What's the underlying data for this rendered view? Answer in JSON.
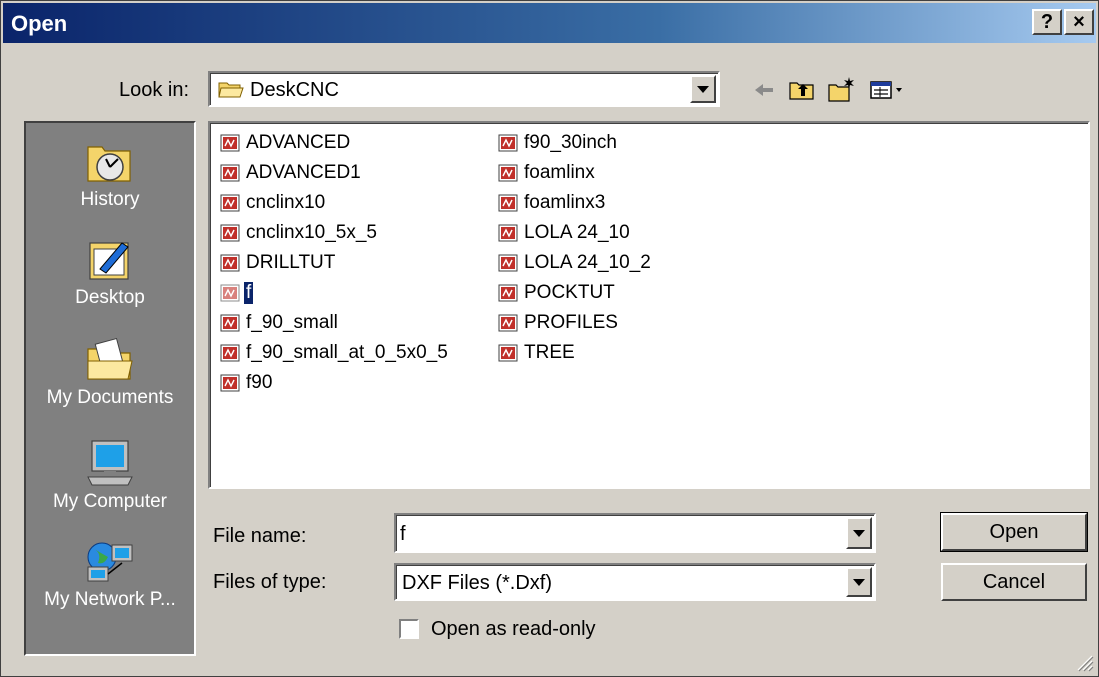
{
  "window": {
    "title": "Open",
    "help_label": "?",
    "close_label": "×"
  },
  "look_in": {
    "label": "Look in:",
    "value": "DeskCNC"
  },
  "toolbar": {
    "icons": [
      "back-arrow-icon",
      "up-one-level-icon",
      "new-folder-icon",
      "view-menu-icon"
    ]
  },
  "places": [
    {
      "label": "History",
      "icon": "history-icon"
    },
    {
      "label": "Desktop",
      "icon": "desktop-icon"
    },
    {
      "label": "My Documents",
      "icon": "my-documents-icon"
    },
    {
      "label": "My Computer",
      "icon": "my-computer-icon"
    },
    {
      "label": "My Network P...",
      "icon": "network-places-icon"
    }
  ],
  "files": {
    "column1": [
      "ADVANCED",
      "ADVANCED1",
      "cnclinx10",
      "cnclinx10_5x_5",
      "DRILLTUT",
      "f",
      "f_90_small",
      "f_90_small_at_0_5x0_5",
      "f90"
    ],
    "column2": [
      "f90_30inch",
      "foamlinx",
      "foamlinx3",
      "LOLA 24_10",
      "LOLA 24_10_2",
      "POCKTUT",
      "PROFILES",
      "TREE"
    ],
    "selected": "f"
  },
  "file_name": {
    "label": "File name:",
    "value": "f"
  },
  "file_type": {
    "label": "Files of type:",
    "value": "DXF Files (*.Dxf)"
  },
  "read_only": {
    "label": "Open as read-only",
    "checked": false
  },
  "buttons": {
    "open": "Open",
    "cancel": "Cancel"
  },
  "colors": {
    "title_bar": "#0a246a",
    "dialog_face": "#d4d0c8",
    "places_bar": "#808080",
    "selection": "#0a246a"
  }
}
